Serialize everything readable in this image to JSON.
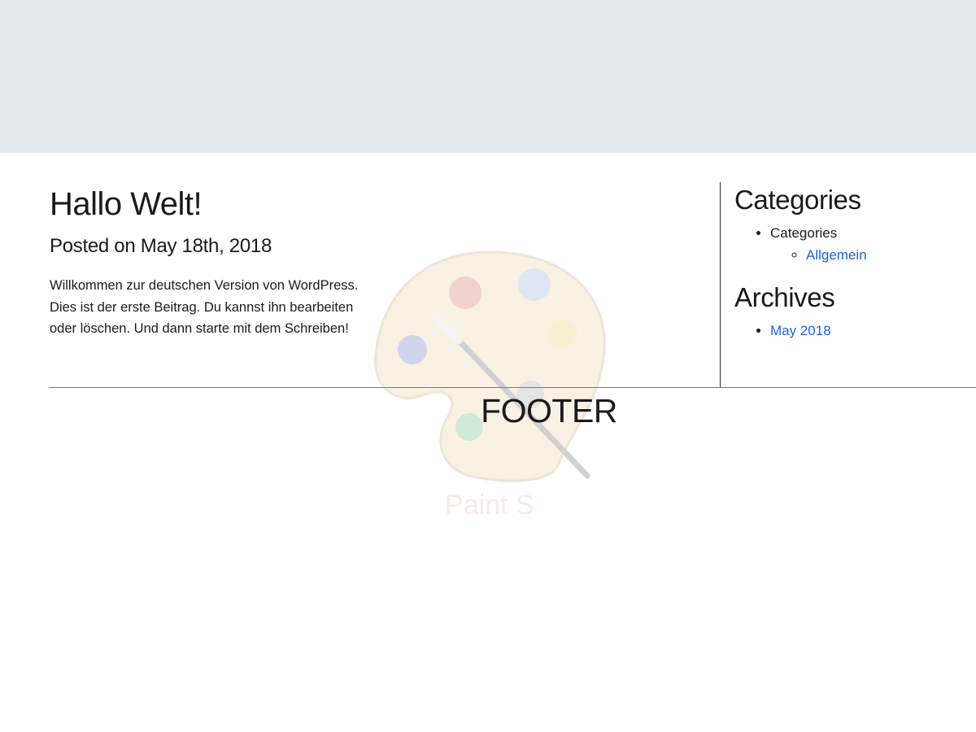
{
  "post": {
    "title": "Hallo Welt!",
    "meta": "Posted on May 18th, 2018",
    "body": "Willkommen zur deutschen Version von WordPress. Dies ist der erste Beitrag. Du kannst ihn bearbeiten oder löschen. Und dann starte mit dem Schreiben!"
  },
  "sidebar": {
    "categories": {
      "title": "Categories",
      "parent_label": "Categories",
      "children": [
        {
          "label": "Allgemein"
        }
      ]
    },
    "archives": {
      "title": "Archives",
      "items": [
        {
          "label": "May 2018"
        }
      ]
    }
  },
  "footer": {
    "label": "FOOTER"
  },
  "watermark": {
    "text": "Paint S",
    "icon": "paint-palette-icon"
  },
  "colors": {
    "top_band": "#e4e7eb",
    "link": "#1f5fe6",
    "text": "#1a1a1a"
  }
}
